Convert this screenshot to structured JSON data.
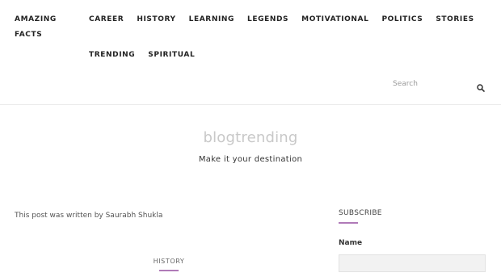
{
  "nav": {
    "left": [
      "AMAZING FACTS"
    ],
    "row1": [
      "CAREER",
      "HISTORY",
      "LEARNING",
      "LEGENDS",
      "MOTIVATIONAL",
      "POLITICS",
      "STORIES"
    ],
    "row2": [
      "TRENDING",
      "SPIRITUAL"
    ]
  },
  "search": {
    "placeholder": "Search",
    "icon": "search-icon"
  },
  "site": {
    "title": "blogtrending",
    "tagline": "Make it your destination"
  },
  "post": {
    "author_note": "This post was written by Saurabh Shukla",
    "category": "HISTORY"
  },
  "sidebar": {
    "widget_title": "SUBSCRIBE",
    "name_label": "Name",
    "accent_color": "#b07ab8"
  }
}
